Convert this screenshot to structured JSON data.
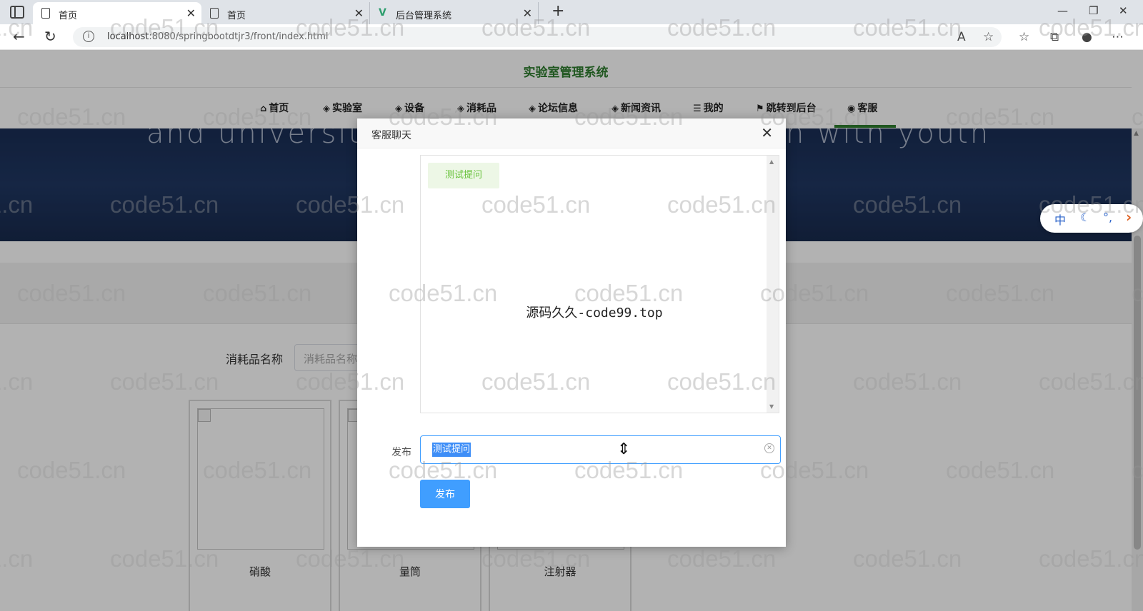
{
  "browser": {
    "tabs": [
      {
        "title": "首页",
        "icon": "document-icon"
      },
      {
        "title": "首页",
        "icon": "document-icon"
      },
      {
        "title": "后台管理系统",
        "icon": "vue-logo-icon"
      }
    ],
    "url_host": "localhost",
    "url_rest": ":8080/springbootdtjr3/front/index.html"
  },
  "site": {
    "title": "实验室管理系统",
    "nav": [
      {
        "label": "首页",
        "icon": "home-icon"
      },
      {
        "label": "实验室",
        "icon": "layers-icon"
      },
      {
        "label": "设备",
        "icon": "layers-icon"
      },
      {
        "label": "消耗品",
        "icon": "layers-icon"
      },
      {
        "label": "论坛信息",
        "icon": "layers-icon"
      },
      {
        "label": "新闻资讯",
        "icon": "layers-icon"
      },
      {
        "label": "我的",
        "icon": "menu-icon"
      },
      {
        "label": "跳转到后台",
        "icon": "flag-icon"
      },
      {
        "label": "客服",
        "icon": "wechat-icon"
      }
    ],
    "active_nav": "客服",
    "banner_text": "and universities",
    "banner_text_right": "h with youth"
  },
  "search": {
    "label": "消耗品名称",
    "placeholder": "消耗品名称"
  },
  "products": [
    {
      "name": "硝酸"
    },
    {
      "name": "量筒"
    },
    {
      "name": "注射器"
    }
  ],
  "ime_pill": {
    "lang": "中",
    "moon": "☾",
    "punct": "°,",
    "arrow": "›"
  },
  "dialog": {
    "title": "客服聊天",
    "messages": [
      {
        "text": "测试提问"
      }
    ],
    "center_text": "源码久久-code99.top",
    "form_label": "发布",
    "input_value": "测试提问",
    "send_label": "发布"
  },
  "watermark": "code51.cn",
  "colors": {
    "accent": "#2f7d2f",
    "primary": "#409eff",
    "message_bg": "#edf7e6",
    "message_text": "#67c23a"
  }
}
